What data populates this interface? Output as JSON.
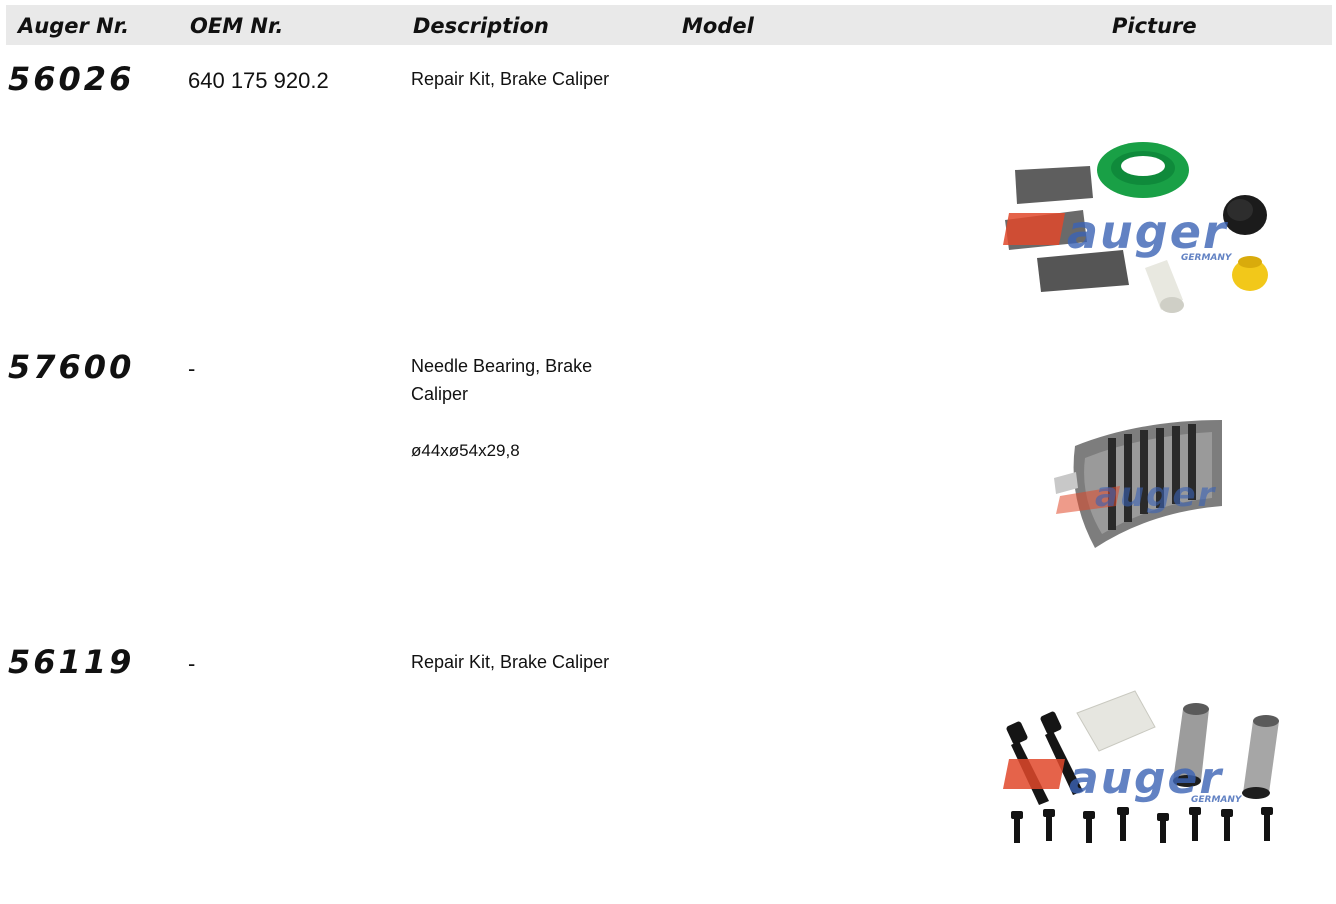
{
  "header": {
    "col_auger": "Auger Nr.",
    "col_oem": "OEM Nr.",
    "col_description": "Description",
    "col_model": "Model",
    "col_picture": "Picture"
  },
  "rows": [
    {
      "auger_nr": "56026",
      "oem_nr": "640 175 920.2",
      "description": "Repair Kit, Brake Caliper",
      "spec": "",
      "picture_icon": "repair-kit-seals-image"
    },
    {
      "auger_nr": "57600",
      "oem_nr": "-",
      "description": "Needle Bearing, Brake Caliper",
      "spec": "ø44xø54x29,8",
      "picture_icon": "needle-bearing-image"
    },
    {
      "auger_nr": "56119",
      "oem_nr": "-",
      "description": "Repair Kit, Brake Caliper",
      "spec": "",
      "picture_icon": "repair-kit-bolts-image"
    }
  ],
  "watermark": {
    "brand": "auger",
    "country": "GERMANY"
  },
  "colors": {
    "header_bg": "#e9e9e9",
    "watermark_blue": "#3b63b5",
    "watermark_red": "#e0482a",
    "seal_green": "#1aa34a",
    "bushing_yellow": "#f2c81a"
  }
}
